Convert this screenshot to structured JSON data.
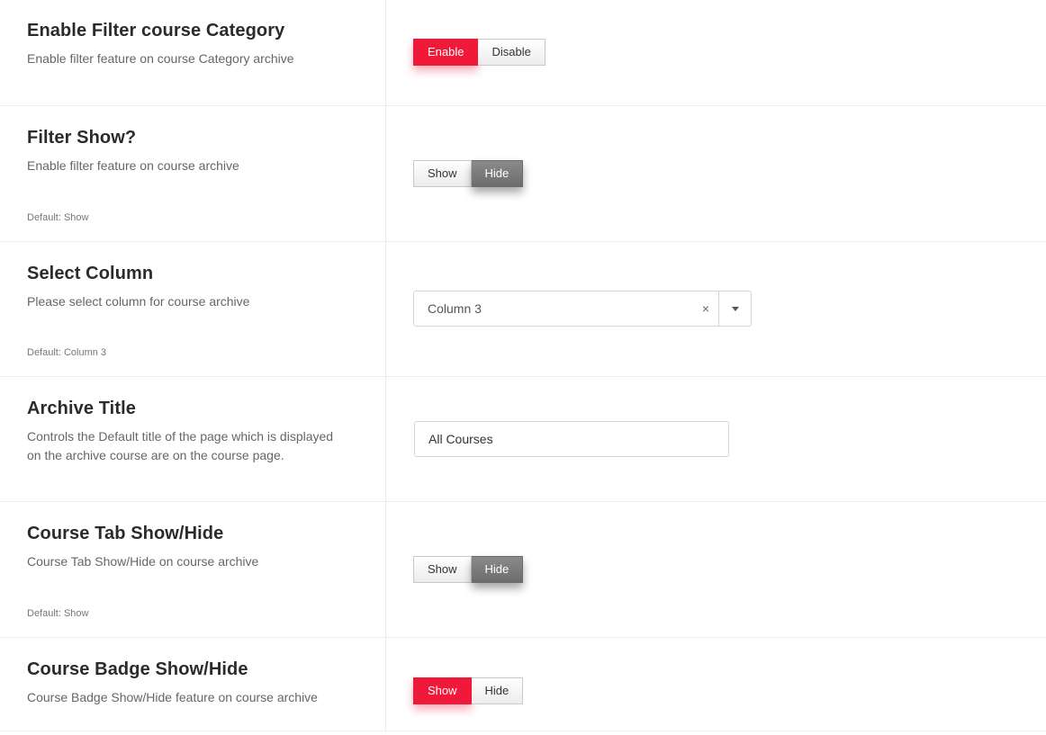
{
  "settings": [
    {
      "title": "Enable Filter course Category",
      "description": "Enable filter feature on course Category archive",
      "options": [
        "Enable",
        "Disable"
      ]
    },
    {
      "title": "Filter Show?",
      "description": "Enable filter feature on course archive",
      "default": "Default: Show",
      "options": [
        "Show",
        "Hide"
      ]
    },
    {
      "title": "Select Column",
      "description": "Please select column for course archive",
      "default": "Default: Column 3",
      "selected": "Column 3",
      "clear": "×"
    },
    {
      "title": "Archive Title",
      "description_line1": "Controls the Default title of the page which is displayed",
      "description_line2": "on the archive course are on the course page.",
      "value": "All Courses"
    },
    {
      "title": "Course Tab Show/Hide",
      "description": "Course Tab Show/Hide on course archive",
      "default": "Default: Show",
      "options": [
        "Show",
        "Hide"
      ]
    },
    {
      "title": "Course Badge Show/Hide",
      "description": "Course Badge Show/Hide feature on course archive",
      "options": [
        "Show",
        "Hide"
      ]
    }
  ],
  "colors": {
    "active_red": "#f0193a",
    "active_gray": "#767676"
  }
}
